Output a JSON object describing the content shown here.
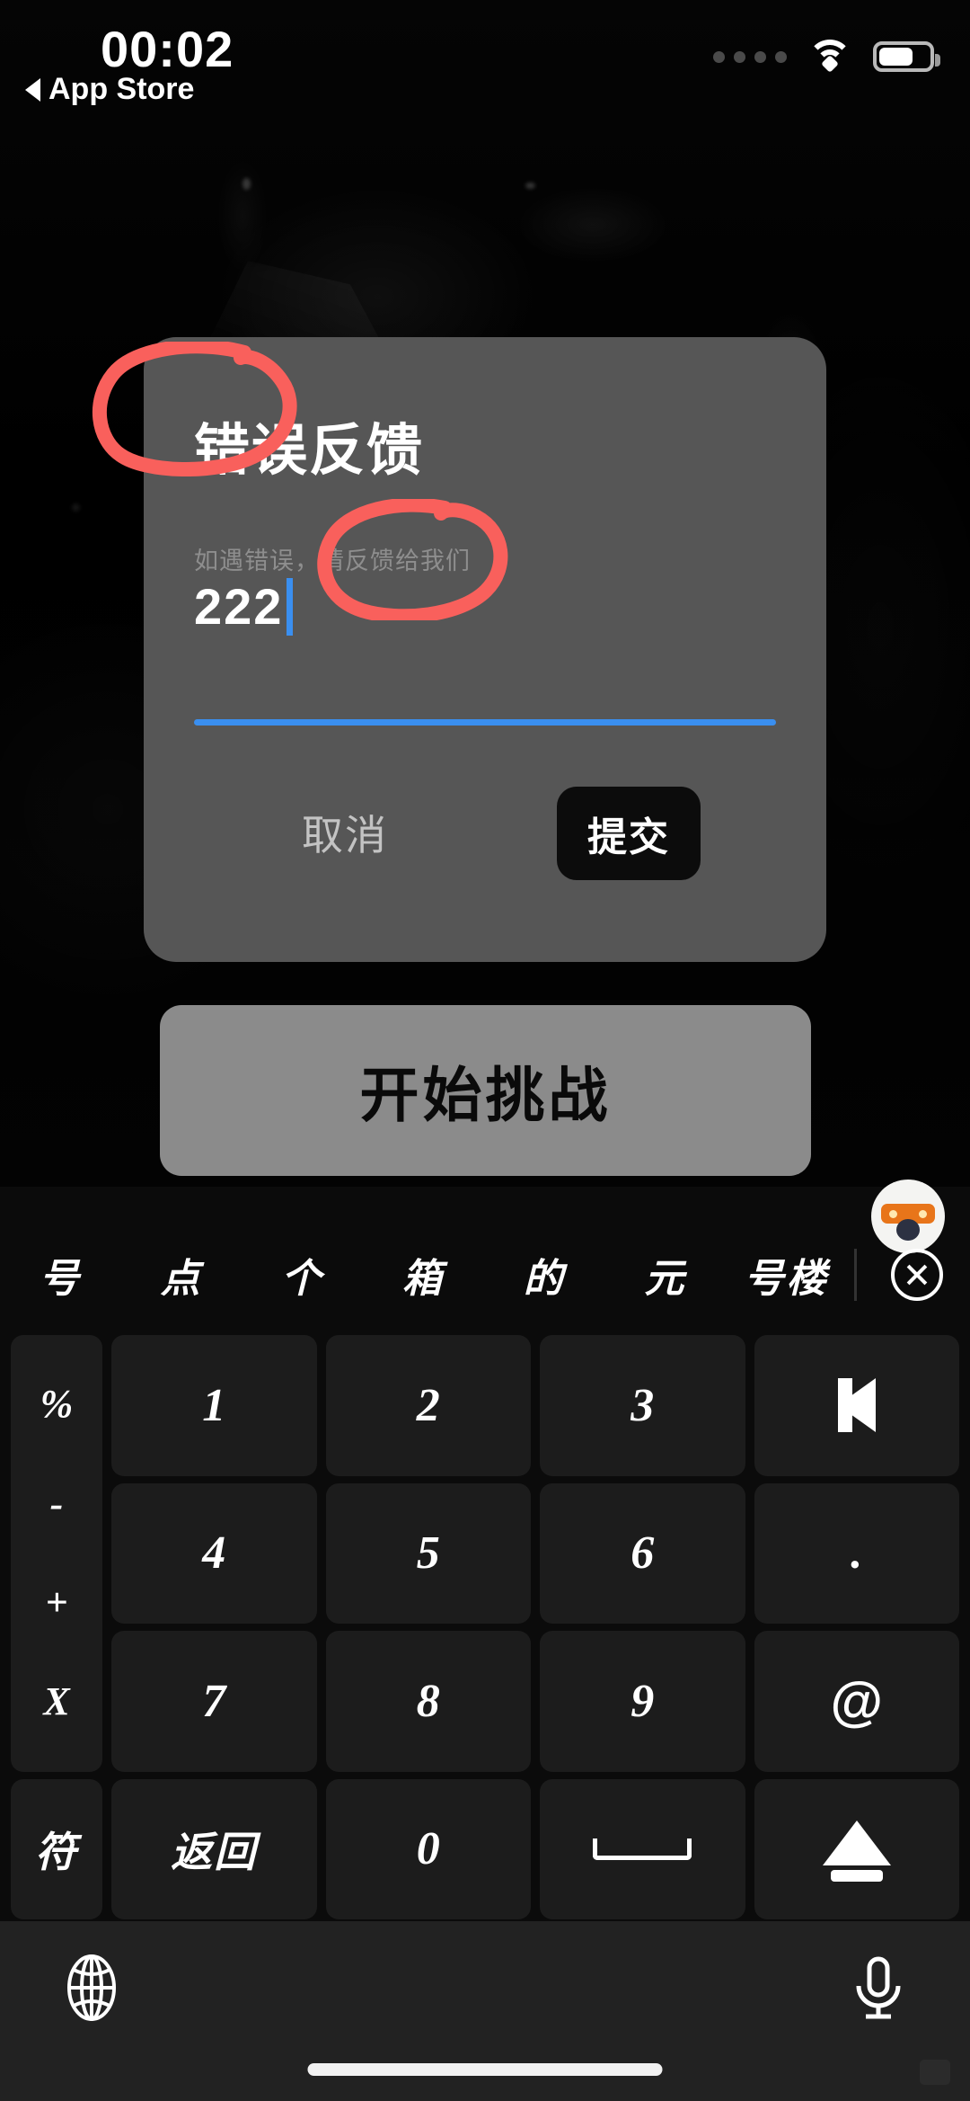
{
  "status_bar": {
    "time": "00:02",
    "back_label": "App Store",
    "back_icon": "left-caret-icon",
    "signal_icon": "signal-dots-icon",
    "wifi_icon": "wifi-icon",
    "battery_icon": "battery-icon"
  },
  "dialog": {
    "title": "错误反馈",
    "field_label": "如遇错误，请反馈给我们",
    "field_value": "222",
    "cancel_label": "取消",
    "submit_label": "提交"
  },
  "main": {
    "start_label": "开始挑战"
  },
  "annotations": {
    "color": "#f9605c",
    "marks": [
      "circle-around-input",
      "circle-around-submit"
    ]
  },
  "keyboard": {
    "avatar_icon": "cat-mascot-avatar",
    "suggestions": [
      "号",
      "点",
      "个",
      "箱",
      "的",
      "元",
      "号楼"
    ],
    "close_icon": "circle-x-icon",
    "symbol_column": [
      "%",
      "-",
      "+",
      "X"
    ],
    "keys": [
      {
        "label": "1",
        "name": "key-1",
        "type": "num"
      },
      {
        "label": "2",
        "name": "key-2",
        "type": "num"
      },
      {
        "label": "3",
        "name": "key-3",
        "type": "num"
      },
      {
        "label": "",
        "name": "backspace-key",
        "type": "backspace"
      },
      {
        "label": "4",
        "name": "key-4",
        "type": "num"
      },
      {
        "label": "5",
        "name": "key-5",
        "type": "num"
      },
      {
        "label": "6",
        "name": "key-6",
        "type": "num"
      },
      {
        "label": ".",
        "name": "key-period",
        "type": "num"
      },
      {
        "label": "7",
        "name": "key-7",
        "type": "num"
      },
      {
        "label": "8",
        "name": "key-8",
        "type": "num"
      },
      {
        "label": "9",
        "name": "key-9",
        "type": "num"
      },
      {
        "label": "@",
        "name": "key-at",
        "type": "at"
      },
      {
        "label": "符",
        "name": "symbols-key",
        "type": "cn"
      },
      {
        "label": "返回",
        "name": "return-key",
        "type": "cn"
      },
      {
        "label": "0",
        "name": "key-0",
        "type": "num"
      },
      {
        "label": "",
        "name": "space-key",
        "type": "space"
      },
      {
        "label": "",
        "name": "hide-keyboard-key",
        "type": "eject"
      }
    ],
    "globe_icon": "globe-icon",
    "mic_icon": "microphone-icon",
    "home_indicator": "home-indicator"
  },
  "colors": {
    "dialog_bg": "#565656",
    "submit_bg": "#0c0c0c",
    "accent_blue": "#3a8ff0",
    "start_btn_bg": "#8b8b8b",
    "keyboard_bg": "#0b0b0b",
    "key_bg": "#1c1c1c"
  }
}
